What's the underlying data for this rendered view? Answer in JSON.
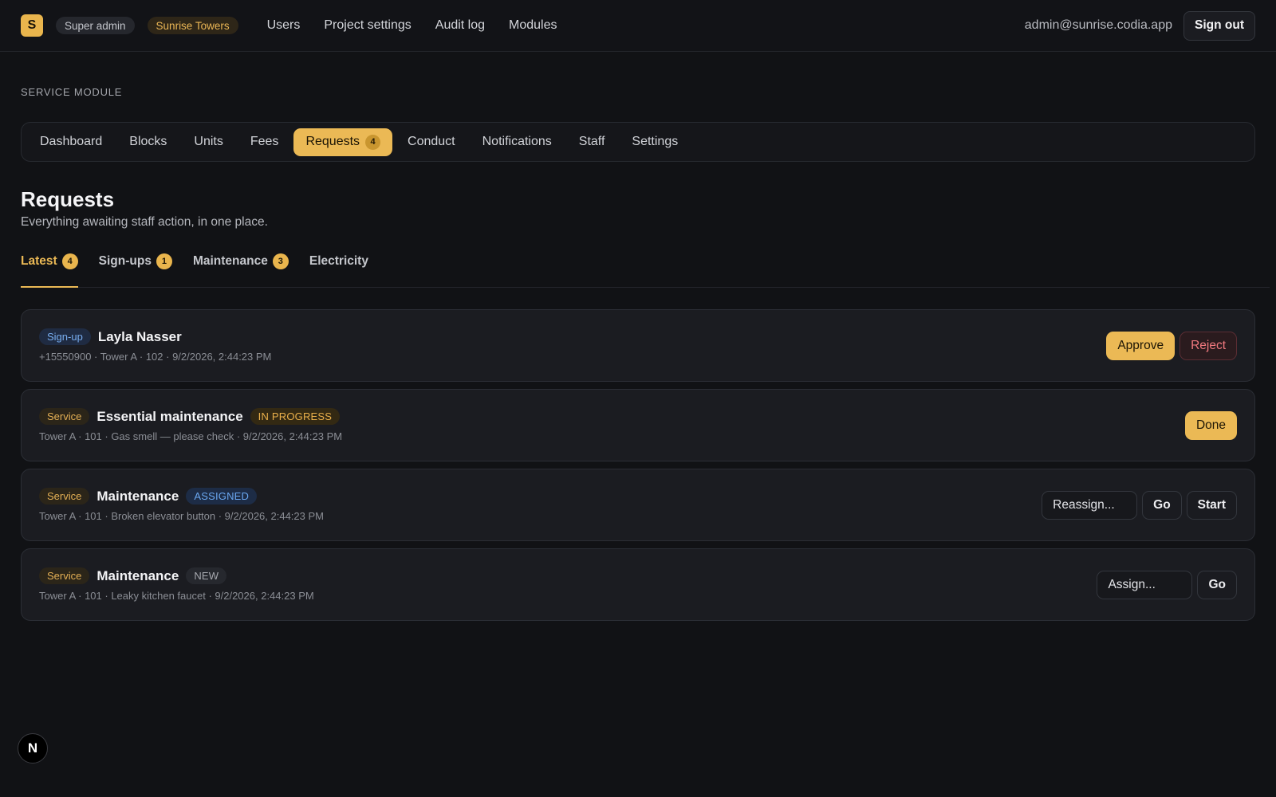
{
  "header": {
    "logo_letter": "S",
    "role_badge": "Super admin",
    "project_badge": "Sunrise Towers",
    "nav": [
      "Users",
      "Project settings",
      "Audit log",
      "Modules"
    ],
    "email": "admin@sunrise.codia.app",
    "sign_out": "Sign out"
  },
  "module": {
    "label": "SERVICE MODULE",
    "tabs": [
      {
        "label": "Dashboard"
      },
      {
        "label": "Blocks"
      },
      {
        "label": "Units"
      },
      {
        "label": "Fees"
      },
      {
        "label": "Requests",
        "count": "4",
        "active": true
      },
      {
        "label": "Conduct"
      },
      {
        "label": "Notifications"
      },
      {
        "label": "Staff"
      },
      {
        "label": "Settings"
      }
    ]
  },
  "page": {
    "title": "Requests",
    "subtitle": "Everything awaiting staff action, in one place."
  },
  "subtabs": [
    {
      "label": "Latest",
      "count": "4"
    },
    {
      "label": "Sign-ups",
      "count": "1"
    },
    {
      "label": "Maintenance",
      "count": "3"
    },
    {
      "label": "Electricity",
      "count": ""
    }
  ],
  "requests": [
    {
      "tag": "Sign-up",
      "title": "Layla Nasser",
      "status": "",
      "meta": "+15550900 · Tower A · 102 · 9/2/2026, 2:44:23 PM",
      "actions": {
        "approve": "Approve",
        "reject": "Reject"
      }
    },
    {
      "tag": "Service",
      "title": "Essential maintenance",
      "status": "IN PROGRESS",
      "meta": "Tower A · 101 · Gas smell — please check · 9/2/2026, 2:44:23 PM",
      "actions": {
        "done": "Done"
      }
    },
    {
      "tag": "Service",
      "title": "Maintenance",
      "status": "ASSIGNED",
      "meta": "Tower A · 101 · Broken elevator button · 9/2/2026, 2:44:23 PM",
      "actions": {
        "select": "Reassign...",
        "go": "Go",
        "start": "Start"
      }
    },
    {
      "tag": "Service",
      "title": "Maintenance",
      "status": "NEW",
      "meta": "Tower A · 101 · Leaky kitchen faucet · 9/2/2026, 2:44:23 PM",
      "actions": {
        "select": "Assign...",
        "go": "Go"
      }
    }
  ],
  "floating_badge": "N",
  "colors": {
    "accent": "#ebb955",
    "background": "#111215",
    "card": "#1b1c21",
    "danger": "#f0797f",
    "info": "#6aa7f0"
  }
}
